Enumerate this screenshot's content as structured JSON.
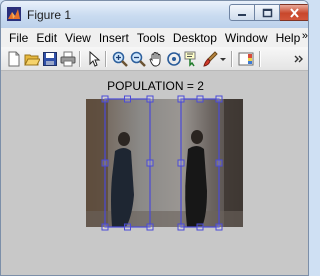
{
  "window": {
    "title": "Figure 1",
    "buttons": {
      "minimize": "minimize-icon",
      "maximize": "maximize-icon",
      "close": "close-icon"
    }
  },
  "menu": {
    "items": [
      "File",
      "Edit",
      "View",
      "Insert",
      "Tools",
      "Desktop",
      "Window",
      "Help"
    ],
    "overflow": "»"
  },
  "toolbar": {
    "icons": [
      "new-figure-icon",
      "open-file-icon",
      "save-icon",
      "print-icon",
      "pointer-icon",
      "zoom-in-icon",
      "zoom-out-icon",
      "pan-icon",
      "rotate-3d-icon",
      "data-cursor-icon",
      "brush-icon",
      "colorbar-icon",
      "more-icon"
    ]
  },
  "figure": {
    "title": "POPULATION = 2",
    "detections": 2,
    "box_color": "#4a4ad8"
  }
}
